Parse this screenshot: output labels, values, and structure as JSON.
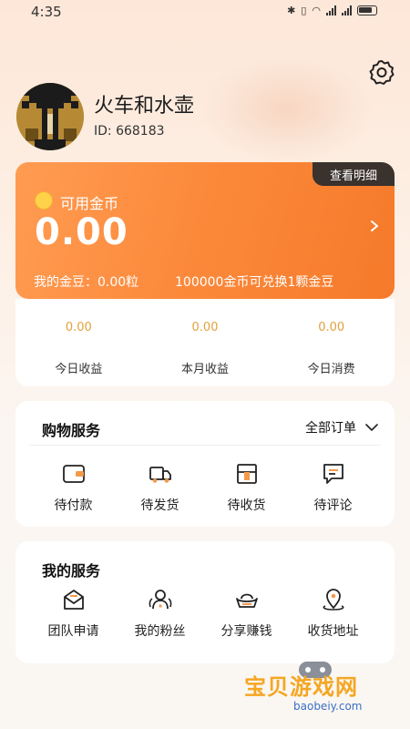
{
  "status": {
    "time": "4:35",
    "battery_icon": "battery-icon",
    "wifi_icon": "wifi-icon"
  },
  "profile": {
    "name": "火车和水壶",
    "id_text": "ID: 668183",
    "settings_icon": "gear-icon"
  },
  "coins": {
    "detail_tab": "查看明细",
    "label": "可用金币",
    "value": "0.00",
    "bean_text": "我的金豆：0.00粒",
    "exchange_text": "100000金币可兑换1颗金豆"
  },
  "stats": [
    {
      "value": "0.00",
      "label": "今日收益"
    },
    {
      "value": "0.00",
      "label": "本月收益"
    },
    {
      "value": "0.00",
      "label": "今日消费"
    }
  ],
  "shopping": {
    "title": "购物服务",
    "all_orders": "全部订单",
    "items": [
      {
        "label": "待付款",
        "icon": "wallet-icon"
      },
      {
        "label": "待发货",
        "icon": "truck-icon"
      },
      {
        "label": "待收货",
        "icon": "package-icon"
      },
      {
        "label": "待评论",
        "icon": "comment-icon"
      }
    ]
  },
  "services": {
    "title": "我的服务",
    "items": [
      {
        "label": "团队申请",
        "icon": "mail-icon"
      },
      {
        "label": "我的粉丝",
        "icon": "fans-icon"
      },
      {
        "label": "分享赚钱",
        "icon": "gold-ingot-icon"
      },
      {
        "label": "收货地址",
        "icon": "location-icon"
      }
    ]
  },
  "watermark": {
    "title": "宝贝游戏网",
    "url": "baobeiy.com"
  },
  "colors": {
    "accent": "#f57a2a",
    "icon_accent": "#f39a4c",
    "stat_value": "#e0a23c"
  }
}
